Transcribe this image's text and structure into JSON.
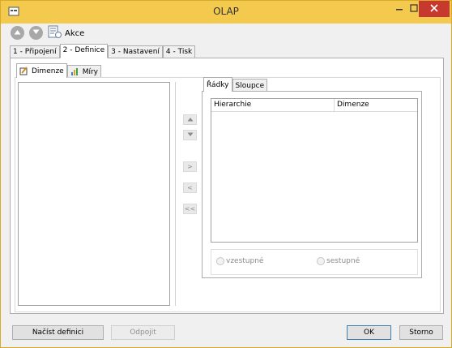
{
  "window": {
    "title": "OLAP"
  },
  "toolbar": {
    "akce_label": "Akce"
  },
  "tabs_main": [
    "1 - Připojení",
    "2 - Definice",
    "3 - Nastavení",
    "4 - Tisk"
  ],
  "tabs_definition": [
    "Dimenze",
    "Míry"
  ],
  "tabs_axes": [
    "Řádky",
    "Sloupce"
  ],
  "grid": {
    "headers": [
      "Hierarchie",
      "Dimenze"
    ]
  },
  "move_buttons": {
    "add": ">",
    "remove": "<",
    "remove_all": "<<"
  },
  "sort": {
    "ascending": "vzestupné",
    "descending": "sestupné"
  },
  "buttons": {
    "load": "Načíst definici",
    "unlink": "Odpojit",
    "ok": "OK",
    "cancel": "Storno"
  }
}
